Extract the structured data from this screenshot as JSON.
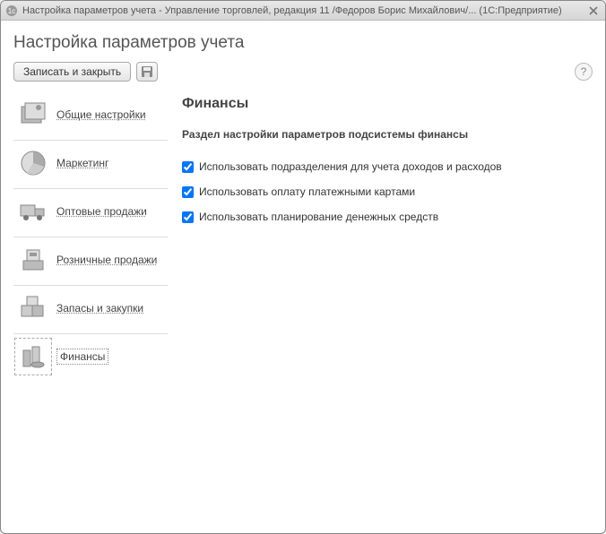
{
  "titlebar": {
    "text": "Настройка параметров учета - Управление торговлей, редакция 11 /Федоров Борис Михайлович/... (1С:Предприятие)"
  },
  "page_title": "Настройка параметров учета",
  "toolbar": {
    "save_close_label": "Записать и закрыть"
  },
  "sidebar": {
    "items": [
      {
        "label": "Общие настройки",
        "icon": "settings-icon"
      },
      {
        "label": "Маркетинг",
        "icon": "chart-icon"
      },
      {
        "label": "Оптовые продажи",
        "icon": "truck-icon"
      },
      {
        "label": "Розничные продажи",
        "icon": "cashreg-icon"
      },
      {
        "label": "Запасы и закупки",
        "icon": "boxes-icon"
      },
      {
        "label": "Финансы",
        "icon": "finance-icon"
      }
    ]
  },
  "main": {
    "title": "Финансы",
    "subtitle": "Раздел настройки параметров подсистемы финансы",
    "options": [
      {
        "label": "Использовать подразделения для учета доходов и расходов",
        "checked": true
      },
      {
        "label": "Использовать оплату платежными картами",
        "checked": true
      },
      {
        "label": "Использовать планирование денежных средств",
        "checked": true
      }
    ]
  }
}
